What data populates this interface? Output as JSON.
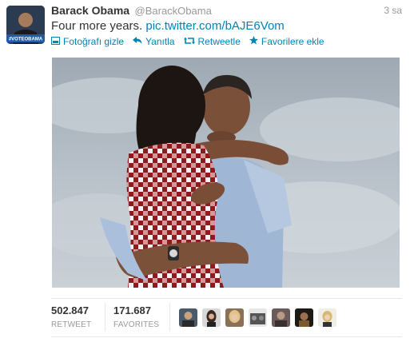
{
  "tweet": {
    "author_name": "Barack Obama",
    "author_handle": "@BarackObama",
    "time": "3 sa",
    "text": "Four more years.",
    "link": "pic.twitter.com/bAJE6Vom",
    "avatar_badge": "#VOTEOBAMA"
  },
  "actions": [
    {
      "label": "Fotoğrafı gizle",
      "icon": "photo-icon"
    },
    {
      "label": "Yanıtla",
      "icon": "reply-icon"
    },
    {
      "label": "Retweetle",
      "icon": "retweet-icon"
    },
    {
      "label": "Favorilere ekle",
      "icon": "star-icon"
    }
  ],
  "stats": {
    "retweets_value": "502.847",
    "retweets_label": "RETWEET",
    "favorites_value": "171.687",
    "favorites_label": "FAVORITES"
  },
  "colors": {
    "link": "#0084b4",
    "muted": "#999999",
    "text": "#333333"
  }
}
